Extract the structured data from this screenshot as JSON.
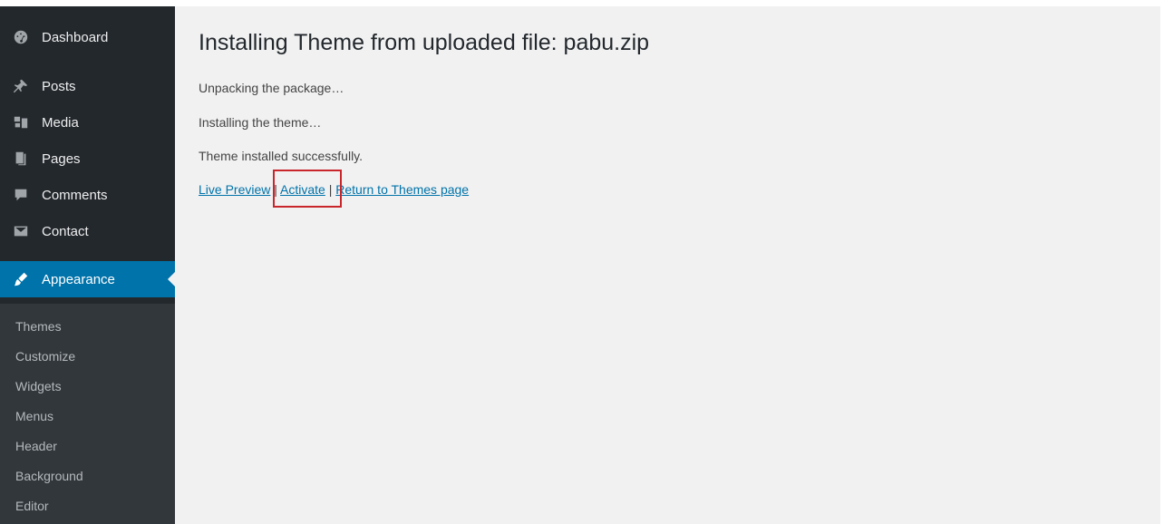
{
  "sidebar": {
    "items": [
      {
        "label": "Dashboard",
        "icon": "dashboard-icon"
      },
      {
        "label": "Posts",
        "icon": "pin-icon"
      },
      {
        "label": "Media",
        "icon": "media-icon"
      },
      {
        "label": "Pages",
        "icon": "pages-icon"
      },
      {
        "label": "Comments",
        "icon": "comment-icon"
      },
      {
        "label": "Contact",
        "icon": "envelope-icon"
      },
      {
        "label": "Appearance",
        "icon": "brush-icon",
        "current": true
      }
    ],
    "submenu": [
      "Themes",
      "Customize",
      "Widgets",
      "Menus",
      "Header",
      "Background",
      "Editor"
    ]
  },
  "main": {
    "title": "Installing Theme from uploaded file: pabu.zip",
    "messages": [
      "Unpacking the package…",
      "Installing the theme…",
      "Theme installed successfully."
    ],
    "links": {
      "live_preview": "Live Preview",
      "activate": "Activate",
      "return": "Return to Themes page",
      "separator": "|"
    }
  },
  "colors": {
    "sidebar_bg": "#23282d",
    "submenu_bg": "#32373c",
    "accent": "#0073aa",
    "highlight": "#c9262c",
    "content_bg": "#f1f1f1"
  }
}
